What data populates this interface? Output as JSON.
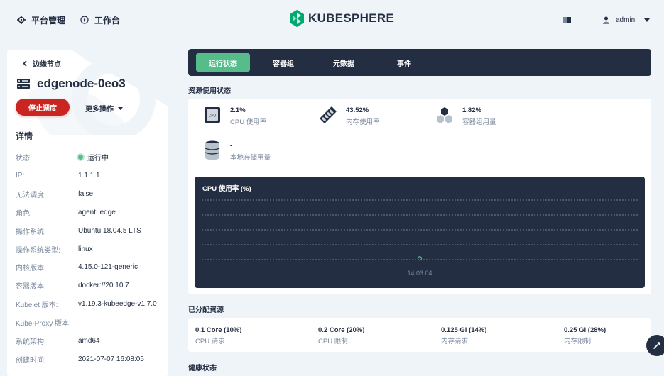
{
  "topnav": {
    "platform_label": "平台管理",
    "workbench_label": "工作台",
    "logo_text": "KUBESPHERE",
    "user_name": "admin"
  },
  "left": {
    "back_label": "边缘节点",
    "node_name": "edgenode-0eo3",
    "stop_label": "停止调度",
    "more_label": "更多操作",
    "details_heading": "详情",
    "details": [
      {
        "key": "状态:",
        "value": "运行中"
      },
      {
        "key": "IP:",
        "value": "1.1.1.1"
      },
      {
        "key": "无法调度:",
        "value": "false"
      },
      {
        "key": "角色:",
        "value": "agent, edge"
      },
      {
        "key": "操作系统:",
        "value": "Ubuntu 18.04.5 LTS"
      },
      {
        "key": "操作系统类型:",
        "value": "linux"
      },
      {
        "key": "内核版本:",
        "value": "4.15.0-121-generic"
      },
      {
        "key": "容器版本:",
        "value": "docker://20.10.7"
      },
      {
        "key": "Kubelet 版本:",
        "value": "v1.19.3-kubeedge-v1.7.0"
      },
      {
        "key": "Kube-Proxy 版本:",
        "value": ""
      },
      {
        "key": "系统架构:",
        "value": "amd64"
      },
      {
        "key": "创建时间:",
        "value": "2021-07-07 16:08:05"
      }
    ]
  },
  "tabs": [
    {
      "label": "运行状态"
    },
    {
      "label": "容器组"
    },
    {
      "label": "元数据"
    },
    {
      "label": "事件"
    }
  ],
  "usage": {
    "title": "资源使用状态",
    "metrics": [
      {
        "value": "2.1%",
        "label": "CPU 使用率",
        "icon": "cpu-icon"
      },
      {
        "value": "43.52%",
        "label": "内存使用率",
        "icon": "memory-icon"
      },
      {
        "value": "1.82%",
        "label": "容器组用量",
        "icon": "pods-icon"
      },
      {
        "value": "-",
        "label": "本地存储用量",
        "icon": "storage-icon"
      }
    ]
  },
  "chart_data": {
    "type": "line",
    "title": "CPU 使用率 (%)",
    "x": [
      "14:03:04"
    ],
    "series": [
      {
        "values": [
          2.1
        ]
      }
    ],
    "xlabel": "",
    "ylabel": "",
    "grid": true,
    "gridlines": 5
  },
  "allocated": {
    "title": "已分配资源",
    "items": [
      {
        "value": "0.1 Core (10%)",
        "label": "CPU 请求"
      },
      {
        "value": "0.2 Core (20%)",
        "label": "CPU 限制"
      },
      {
        "value": "0.125 Gi (14%)",
        "label": "内存请求"
      },
      {
        "value": "0.25 Gi (28%)",
        "label": "内存限制"
      }
    ]
  },
  "health": {
    "title": "健康状态"
  },
  "colors": {
    "accent": "#55bc8a",
    "dark": "#242e42",
    "danger": "#ca2621",
    "muted": "#79879c",
    "background": "#eff4f9"
  }
}
